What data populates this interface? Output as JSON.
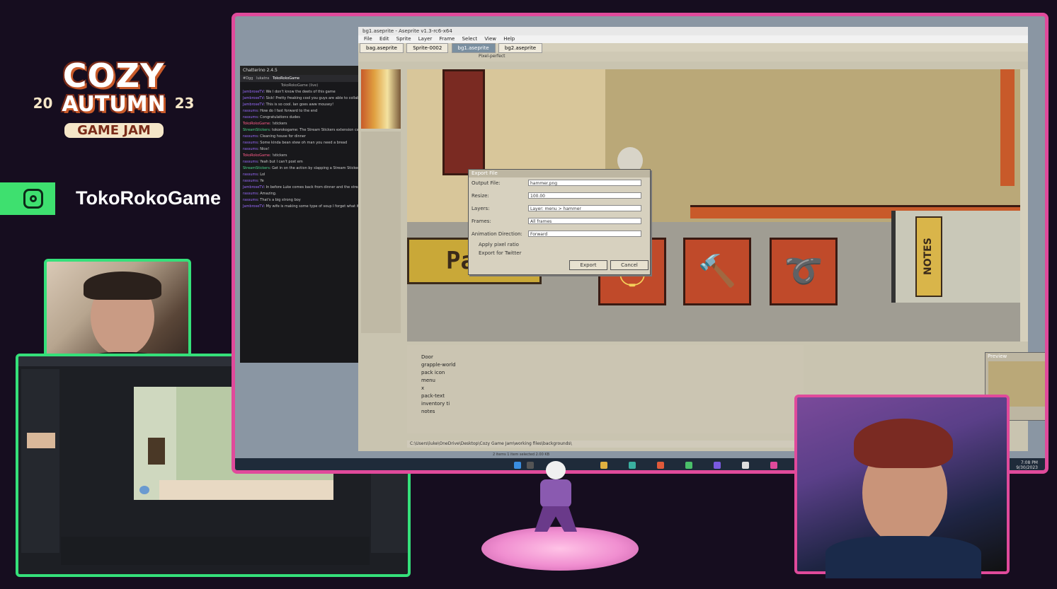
{
  "branding": {
    "logo_line1": "COZY",
    "logo_line2": "AUTUMN",
    "logo_line3": "GAME JAM",
    "year_left": "20",
    "year_right": "23",
    "handle": "TokoRokoGame",
    "insta_icon": "instagram-icon"
  },
  "chat": {
    "title": "Chatterino 2.4.5",
    "tabs": [
      "#Dgg",
      "lukatns",
      "TokoRokoGame"
    ],
    "channel": "TokoRokoGame (live)",
    "messages": [
      {
        "user": "JambroseTV",
        "text": "We I don't know the deets of this game"
      },
      {
        "user": "JambroseTV",
        "text": "Sick! Pretty freaking cool you guys are able to collab on this. Legit"
      },
      {
        "user": "JambroseTV",
        "text": "This is so cool. Ian goes aww mousey!"
      },
      {
        "user": "rassums",
        "text": "How do I fast forward to the end"
      },
      {
        "user": "rassums",
        "text": "Congratulations dudes"
      },
      {
        "user": "TokoRokoGame",
        "text": "!stickers"
      },
      {
        "user": "StreamStickers",
        "text": "tokorokogame: The Stream Stickers extension can be found by either hovering over the live view"
      },
      {
        "user": "rassums",
        "text": "Cleaning house for dinner"
      },
      {
        "user": "rassums",
        "text": "Some kinda bean stew oh man you need a bread"
      },
      {
        "user": "rassums",
        "text": "Nice!"
      },
      {
        "user": "TokoRokoGame",
        "text": "!stickers"
      },
      {
        "user": "rassums",
        "text": "Yeah but I can't post em"
      },
      {
        "user": "StreamStickers",
        "text": "Get in on the action by slapping a Stream Sticker! Type !stickers to learn how."
      },
      {
        "user": "rassums",
        "text": "Lol"
      },
      {
        "user": "rassums",
        "text": "Ye"
      },
      {
        "user": "JambroseTV",
        "text": "In before Luke comes back from dinner and the stream is nothing but stickers."
      },
      {
        "user": "rassums",
        "text": "Amazing."
      },
      {
        "user": "rassums",
        "text": "That's a big strong boy"
      },
      {
        "user": "JambroseTV",
        "text": "My wife is making some type of soup I forget what it is"
      }
    ]
  },
  "aseprite": {
    "title": "bg1.aseprite - Aseprite v1.3-rc6-x64",
    "menu": [
      "File",
      "Edit",
      "Sprite",
      "Layer",
      "Frame",
      "Select",
      "View",
      "Help"
    ],
    "tabs": [
      "bag.aseprite",
      "Sprite-0002",
      "bg1.aseprite",
      "bg2.aseprite"
    ],
    "active_tab": 2,
    "toolbar_hint": "Pixel-perfect",
    "pack_label": "Pack",
    "notes_label": "NOTES",
    "dialog": {
      "title": "Export File",
      "output_label": "Output File:",
      "output_value": "hammer.png",
      "resize_label": "Resize:",
      "resize_value": "100.00",
      "layers_label": "Layers:",
      "layers_value": "Layer: menu > hammer",
      "frames_label": "Frames:",
      "frames_value": "All frames",
      "direction_label": "Animation Direction:",
      "direction_value": "Forward",
      "pixel_ratio": "Apply pixel ratio",
      "twitter": "Export for Twitter",
      "export_btn": "Export",
      "cancel_btn": "Cancel"
    },
    "layers": [
      "Door",
      "grapple-world",
      "pack icon",
      "menu",
      "x",
      "pack-text",
      "inventory ti",
      "notes"
    ],
    "status": "C:\\Users\\luke\\OneDrive\\Desktop\\Cozy Game Jam\\working files\\backgrounds\\",
    "explorer_status": "2 items   1 item selected  2.00 KB",
    "preview_label": "Preview",
    "clock_time": "7:08 PM",
    "clock_date": "9/30/2023"
  },
  "colors": {
    "background": "#160d1f",
    "frame_green": "#35e07a",
    "frame_pink": "#e04a9b",
    "insta_green": "#3ee06f"
  }
}
